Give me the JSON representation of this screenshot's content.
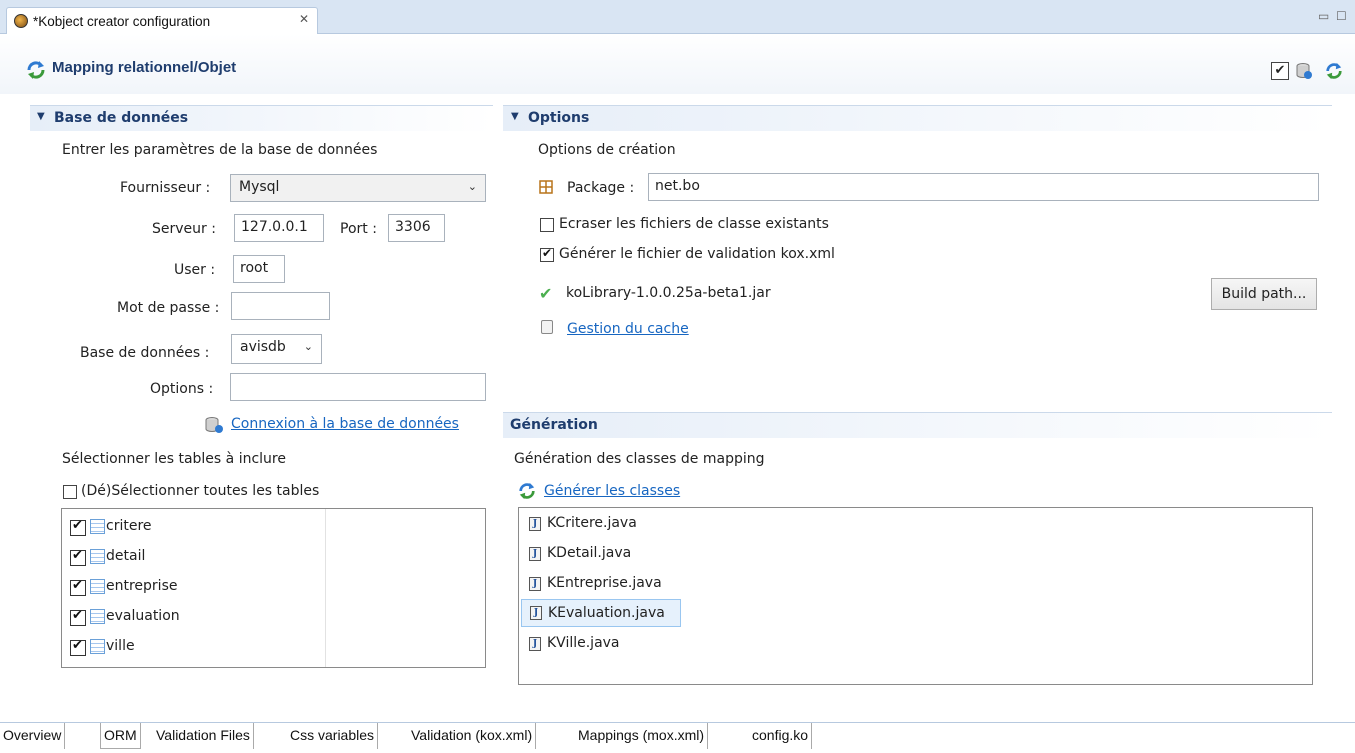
{
  "editor_tab": {
    "title": "*Kobject creator configuration"
  },
  "header": {
    "title": "Mapping relationnel/Objet"
  },
  "database": {
    "section_title": "Base de données",
    "description": "Entrer les paramètres de la base de données",
    "provider_label": "Fournisseur :",
    "provider_value": "Mysql",
    "server_label": "Serveur :",
    "server_value": "127.0.0.1",
    "port_label": "Port :",
    "port_value": "3306",
    "user_label": "User :",
    "user_value": "root",
    "password_label": "Mot de passe :",
    "password_value": "",
    "dbname_label": "Base de données :",
    "dbname_value": "avisdb",
    "options_label": "Options :",
    "options_value": "",
    "connect_link": "Connexion à la base de données",
    "select_tables_label": "Sélectionner les tables à inclure",
    "select_all_label": "(Dé)Sélectionner toutes les tables",
    "tables": [
      {
        "name": "critere",
        "checked": true
      },
      {
        "name": "detail",
        "checked": true
      },
      {
        "name": "entreprise",
        "checked": true
      },
      {
        "name": "evaluation",
        "checked": true
      },
      {
        "name": "ville",
        "checked": true
      }
    ]
  },
  "options": {
    "section_title": "Options",
    "description": "Options de création",
    "package_label": "Package :",
    "package_value": "net.bo",
    "overwrite_label": "Ecraser les fichiers de classe existants",
    "overwrite_checked": false,
    "validation_label": "Générer le fichier de validation kox.xml",
    "validation_checked": true,
    "library_label": "koLibrary-1.0.0.25a-beta1.jar",
    "build_path_button": "Build path...",
    "cache_link": "Gestion du cache"
  },
  "generation": {
    "section_title": "Génération",
    "description": "Génération des classes de mapping",
    "generate_link": "Générer les classes",
    "classes": [
      "KCritere.java",
      "KDetail.java",
      "KEntreprise.java",
      "KEvaluation.java",
      "KVille.java"
    ],
    "selected_class": "KEvaluation.java"
  },
  "page_tabs": {
    "items": [
      "Overview",
      "ORM",
      "Validation Files",
      "Css variables",
      "Validation (kox.xml)",
      "Mappings (mox.xml)",
      "config.ko"
    ],
    "active": "ORM"
  },
  "colors": {
    "section_title": "#1f3d6e",
    "link": "#1766c1",
    "tab_bar": "#d9e5f3"
  }
}
